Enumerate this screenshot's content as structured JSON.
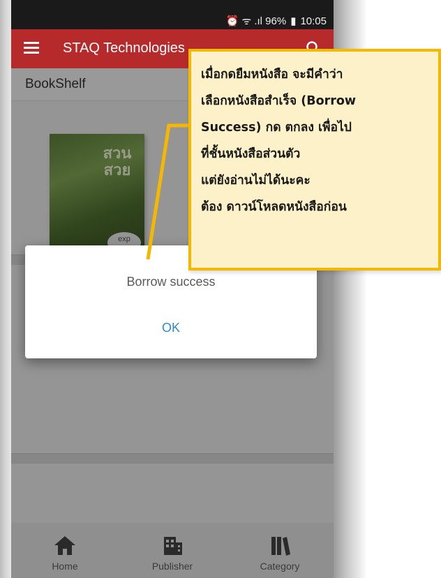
{
  "status_bar": {
    "indicators": "⏰ ᯤ .ıl 96%",
    "battery": "▮",
    "time": "10:05"
  },
  "app_bar": {
    "title": "STAQ Technologies",
    "menu_icon": "menu-icon",
    "search_icon": "search-icon"
  },
  "subheader": {
    "title": "BookShelf"
  },
  "book": {
    "cover_text": "สวน สวย",
    "badge": "exp"
  },
  "dialog": {
    "message": "Borrow success",
    "ok_label": "OK"
  },
  "bottom_nav": [
    {
      "label": "Home",
      "icon": "home-icon"
    },
    {
      "label": "Publisher",
      "icon": "building-icon"
    },
    {
      "label": "Category",
      "icon": "books-icon"
    }
  ],
  "callout": {
    "lines": [
      "เมื่อกดยืมหนังสือ จะมีคำว่า",
      "เลือกหนังสือสำเร็จ (Borrow",
      "Success) กด ตกลง เพื่อไป",
      "ที่ชั้นหนังสือส่วนตัว",
      "แต่ยังอ่านไม่ได้นะคะ",
      "ต้อง ดาวน์โหลดหนังสือก่อน"
    ]
  },
  "colors": {
    "app_bar": "#b72a2c",
    "callout_border": "#f5b800",
    "callout_fill": "#fdf1c9",
    "ok_text": "#2b8ad6"
  }
}
